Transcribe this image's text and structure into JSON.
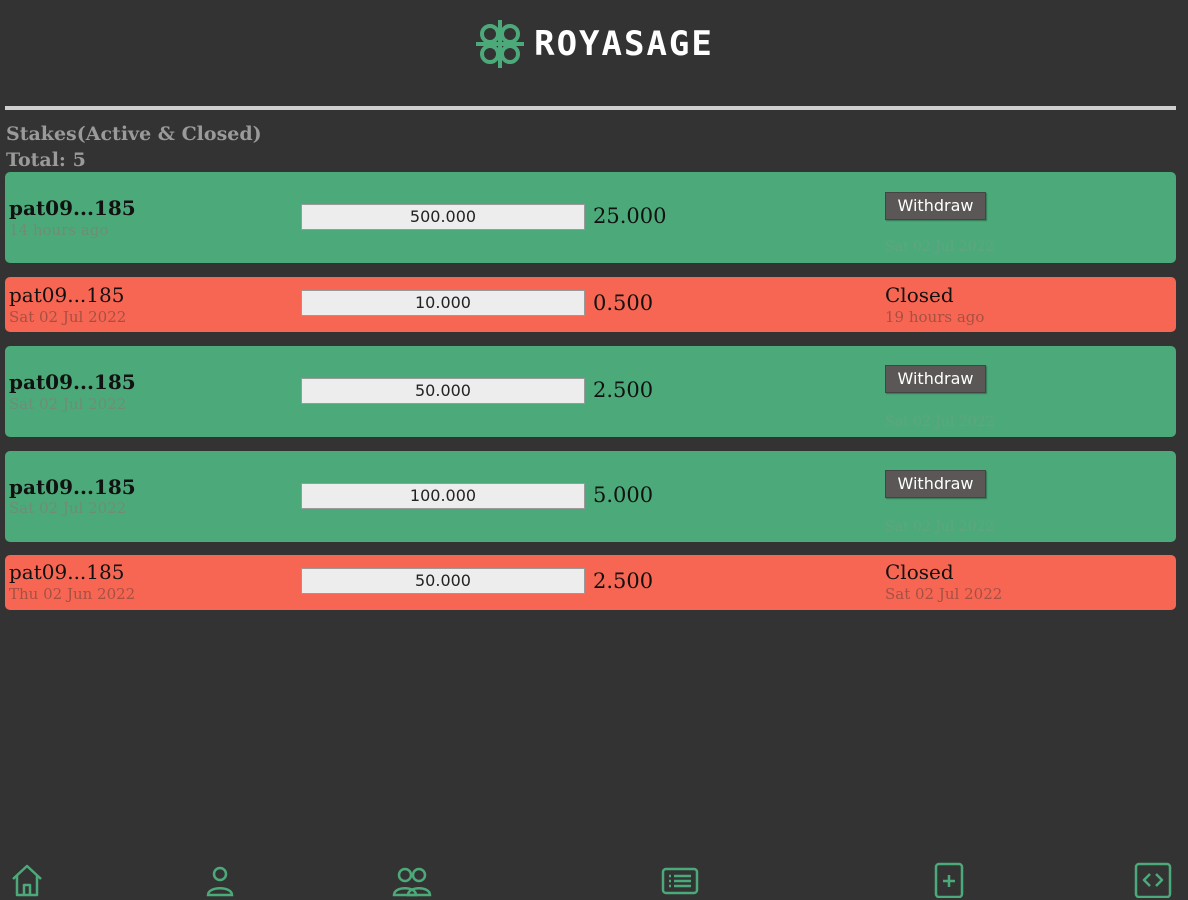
{
  "brand": {
    "name": "ROYASAGE",
    "accent_color": "#4caa7a"
  },
  "section": {
    "title": "Stakes(Active & Closed)",
    "total_label": "Total: 5"
  },
  "stakes": [
    {
      "status": "active",
      "address": "pat09...185",
      "time": "14 hours ago",
      "amount": "500.000",
      "reward": "25.000",
      "action_label": "Withdraw",
      "action_date": "Sat 02 Jul 2022"
    },
    {
      "status": "closed",
      "address": "pat09...185",
      "time": "Sat 02 Jul 2022",
      "amount": "10.000",
      "reward": "0.500",
      "status_label": "Closed",
      "status_time": "19 hours ago"
    },
    {
      "status": "active",
      "address": "pat09...185",
      "time": "Sat 02 Jul 2022",
      "amount": "50.000",
      "reward": "2.500",
      "action_label": "Withdraw",
      "action_date": "Sat 02 Jul 2022"
    },
    {
      "status": "active",
      "address": "pat09...185",
      "time": "Sat 02 Jul 2022",
      "amount": "100.000",
      "reward": "5.000",
      "action_label": "Withdraw",
      "action_date": "Sat 02 Jul 2022"
    },
    {
      "status": "closed",
      "address": "pat09...185",
      "time": "Thu 02 Jun 2022",
      "amount": "50.000",
      "reward": "2.500",
      "status_label": "Closed",
      "status_time": "Sat 02 Jul 2022"
    }
  ],
  "colors": {
    "active": "#4caa7a",
    "closed": "#f76652",
    "background": "#333333"
  },
  "nav": {
    "icons": [
      "home-icon",
      "profile-icon",
      "team-icon",
      "list-icon",
      "add-stake-icon",
      "code-icon"
    ]
  }
}
